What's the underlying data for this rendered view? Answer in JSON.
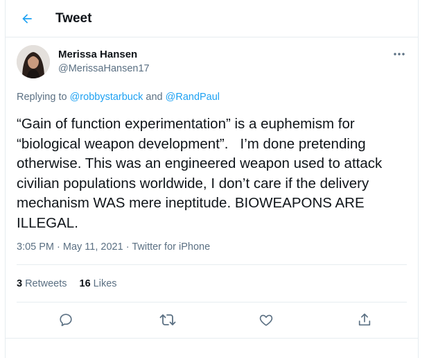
{
  "header": {
    "title": "Tweet",
    "back_icon": "arrow-left-icon"
  },
  "author": {
    "name": "Merissa Hansen",
    "handle": "@MerissaHansen17"
  },
  "reply": {
    "prefix": "Replying to ",
    "mention1": "@robbystarbuck",
    "conjunction": " and ",
    "mention2": "@RandPaul"
  },
  "tweet": {
    "text": "“Gain of function experimentation” is a euphemism for “biological weapon development”.   I’m done pretending otherwise. This was an engineered weapon used to attack civilian populations worldwide, I don’t care if the delivery mechanism WAS mere ineptitude. BIOWEAPONS ARE ILLEGAL."
  },
  "meta": {
    "time": "3:05 PM",
    "sep1": " · ",
    "date": "May 11, 2021",
    "sep2": " · ",
    "source": "Twitter for iPhone"
  },
  "stats": {
    "retweets_count": "3",
    "retweets_label": "Retweets",
    "likes_count": "16",
    "likes_label": "Likes"
  },
  "actions": [
    "reply-icon",
    "retweet-icon",
    "like-icon",
    "share-icon"
  ],
  "colors": {
    "accent": "#1da1f2",
    "secondary_text": "#5b7083",
    "border": "#e6ecf0"
  }
}
